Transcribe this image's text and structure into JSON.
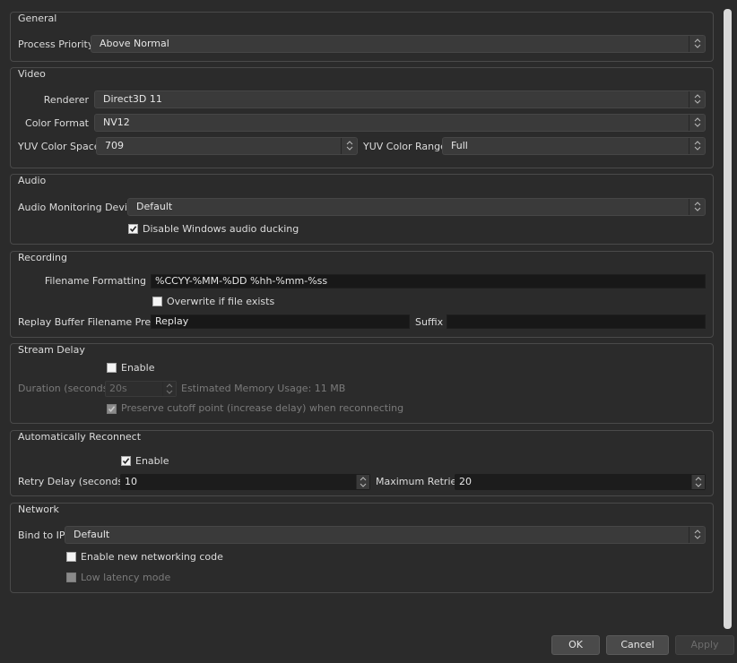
{
  "general": {
    "title": "General",
    "process_priority_label": "Process Priority",
    "process_priority_value": "Above Normal"
  },
  "video": {
    "title": "Video",
    "renderer_label": "Renderer",
    "renderer_value": "Direct3D 11",
    "color_format_label": "Color Format",
    "color_format_value": "NV12",
    "yuv_space_label": "YUV Color Space",
    "yuv_space_value": "709",
    "yuv_range_label": "YUV Color Range",
    "yuv_range_value": "Full"
  },
  "audio": {
    "title": "Audio",
    "monitoring_label": "Audio Monitoring Device",
    "monitoring_value": "Default",
    "ducking_label": "Disable Windows audio ducking",
    "ducking_checked": true
  },
  "recording": {
    "title": "Recording",
    "filename_label": "Filename Formatting",
    "filename_value": "%CCYY-%MM-%DD %hh-%mm-%ss",
    "overwrite_label": "Overwrite if file exists",
    "overwrite_checked": false,
    "replay_prefix_label": "Replay Buffer Filename Prefix",
    "replay_prefix_value": "Replay",
    "suffix_label": "Suffix",
    "suffix_value": ""
  },
  "stream_delay": {
    "title": "Stream Delay",
    "enable_label": "Enable",
    "enable_checked": false,
    "duration_label": "Duration (seconds)",
    "duration_value": "20s",
    "memory_label": "Estimated Memory Usage: 11 MB",
    "preserve_label": "Preserve cutoff point (increase delay) when reconnecting",
    "preserve_checked": true
  },
  "reconnect": {
    "title": "Automatically Reconnect",
    "enable_label": "Enable",
    "enable_checked": true,
    "retry_delay_label": "Retry Delay (seconds)",
    "retry_delay_value": "10",
    "max_retries_label": "Maximum Retries",
    "max_retries_value": "20"
  },
  "network": {
    "title": "Network",
    "bind_ip_label": "Bind to IP",
    "bind_ip_value": "Default",
    "new_net_label": "Enable new networking code",
    "new_net_checked": false,
    "low_latency_label": "Low latency mode",
    "low_latency_checked": false
  },
  "buttons": {
    "ok": "OK",
    "cancel": "Cancel",
    "apply": "Apply"
  },
  "colors": {
    "background": "#2b2b2b",
    "control": "#3a3a3a",
    "input": "#181818",
    "text": "#dcdcdc",
    "disabled_text": "#7a7a7a",
    "border": "#4a4a4a"
  },
  "icons": {
    "combo_arrows": "chevron-up-down-icon",
    "spin_arrows": "spin-up-down-icon",
    "checkmark": "checkmark-icon"
  }
}
